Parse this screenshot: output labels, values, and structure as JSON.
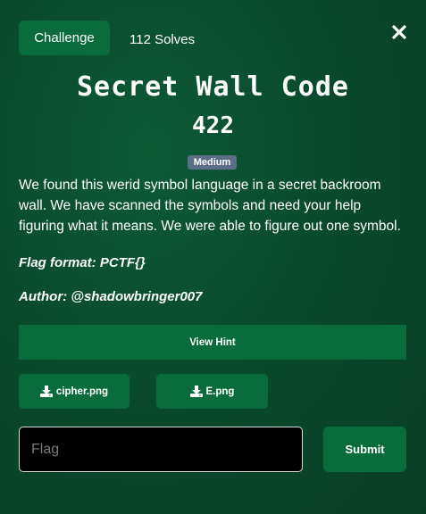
{
  "header": {
    "tab_label": "Challenge",
    "solves": "112 Solves",
    "close_symbol": "✕"
  },
  "challenge": {
    "title": "Secret Wall Code",
    "points": "422",
    "difficulty": "Medium",
    "description": "We found this werid symbol language in a secret backroom wall. We have scanned the symbols and need your help figuring what it means. We were able to figure out one symbol.",
    "flag_format": "Flag format: PCTF{}",
    "author": "Author: @shadowbringer007"
  },
  "actions": {
    "hint_label": "View Hint",
    "files": [
      "cipher.png",
      "E.png"
    ],
    "submit_label": "Submit"
  },
  "flag_input": {
    "placeholder": "Flag",
    "value": ""
  },
  "colors": {
    "accent": "#0a6b3d",
    "background": "#0a4a2d",
    "badge": "#5b6e86"
  },
  "icons": {
    "download": "download-icon",
    "close": "close-icon"
  }
}
